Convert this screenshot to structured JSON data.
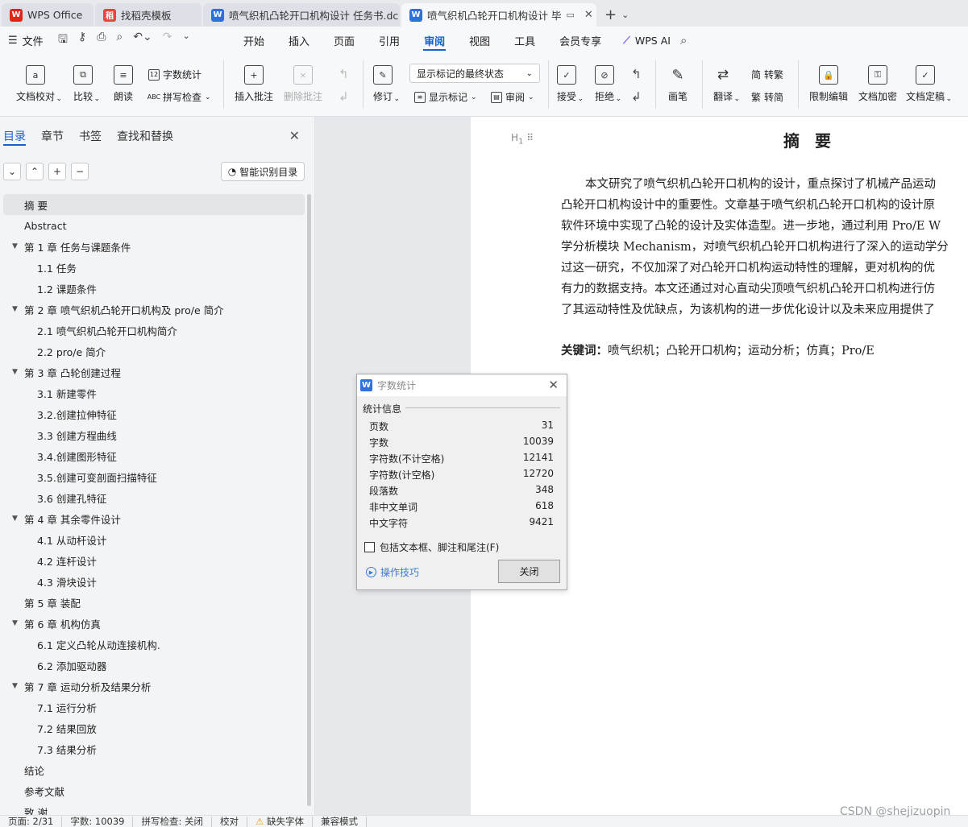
{
  "tabs": [
    {
      "label": "WPS Office",
      "icon": "wps-logo-icon",
      "color": "#e0261b"
    },
    {
      "label": "找稻壳模板",
      "icon": "docer-icon",
      "color": "#e8453c"
    },
    {
      "label": "喷气织机凸轮开口机构设计 任务书.dc",
      "icon": "word-doc-icon",
      "color": "#2f6fde"
    },
    {
      "label": "喷气织机凸轮开口机构设计 毕",
      "icon": "word-doc-icon",
      "color": "#2f6fde"
    }
  ],
  "menu": {
    "file": "文件",
    "tabs": [
      "开始",
      "插入",
      "页面",
      "引用",
      "审阅",
      "视图",
      "工具",
      "会员专享"
    ],
    "active_tab": "审阅",
    "wps_ai": "WPS AI"
  },
  "ribbon": {
    "doc_proof": "文档校对",
    "compare": "比较",
    "read_aloud": "朗读",
    "word_count": "字数统计",
    "spell_check": "拼写检查",
    "insert_comment": "插入批注",
    "delete_comment": "删除批注",
    "track_changes": "修订",
    "markup_state": "显示标记的最终状态",
    "show_markup": "显示标记",
    "review": "审阅",
    "accept": "接受",
    "reject": "拒绝",
    "pen": "画笔",
    "translate": "翻译",
    "to_traditional": "转繁",
    "to_simplified": "转简",
    "restrict_edit": "限制编辑",
    "encrypt": "文档加密",
    "finalize": "文档定稿"
  },
  "nav": {
    "tabs": [
      "目录",
      "章节",
      "书签",
      "查找和替换"
    ],
    "smart_toc": "智能识别目录",
    "toc": [
      {
        "text": "摘  要",
        "level": 0,
        "expand": false,
        "selected": true
      },
      {
        "text": "Abstract",
        "level": 0,
        "expand": false
      },
      {
        "text": "第 1 章  任务与课题条件",
        "level": 0,
        "expand": true
      },
      {
        "text": "1.1  任务",
        "level": 1
      },
      {
        "text": "1.2  课题条件",
        "level": 1
      },
      {
        "text": "第 2 章  喷气织机凸轮开口机构及 pro/e 简介",
        "level": 0,
        "expand": true
      },
      {
        "text": "2.1  喷气织机凸轮开口机构简介",
        "level": 1
      },
      {
        "text": "2.2 pro/e 简介",
        "level": 1
      },
      {
        "text": "第 3 章  凸轮创建过程",
        "level": 0,
        "expand": true
      },
      {
        "text": "3.1  新建零件",
        "level": 1
      },
      {
        "text": "3.2.创建拉伸特征",
        "level": 1
      },
      {
        "text": "3.3  创建方程曲线",
        "level": 1
      },
      {
        "text": "3.4.创建图形特征",
        "level": 1
      },
      {
        "text": "3.5.创建可变剖面扫描特征",
        "level": 1
      },
      {
        "text": "3.6 创建孔特征",
        "level": 1
      },
      {
        "text": "第 4 章    其余零件设计",
        "level": 0,
        "expand": true
      },
      {
        "text": "4.1 从动杆设计",
        "level": 1
      },
      {
        "text": "4.2 连杆设计",
        "level": 1
      },
      {
        "text": "4.3 滑块设计",
        "level": 1
      },
      {
        "text": "第 5 章  装配",
        "level": 0,
        "expand": false
      },
      {
        "text": "第 6 章  机构仿真",
        "level": 0,
        "expand": true
      },
      {
        "text": "6.1  定义凸轮从动连接机构.",
        "level": 1
      },
      {
        "text": "6.2  添加驱动器",
        "level": 1
      },
      {
        "text": "第 7 章    运动分析及结果分析",
        "level": 0,
        "expand": true
      },
      {
        "text": "7.1  运行分析",
        "level": 1
      },
      {
        "text": "7.2    结果回放",
        "level": 1
      },
      {
        "text": "7.3    结果分析",
        "level": 1
      },
      {
        "text": "结论",
        "level": 0,
        "expand": false
      },
      {
        "text": "参考文献",
        "level": 0,
        "expand": false
      },
      {
        "text": "致  谢",
        "level": 0,
        "expand": false
      }
    ]
  },
  "document": {
    "heading_marker": "H",
    "title": "摘 要",
    "lines": [
      "本文研究了喷气织机凸轮开口机构的设计，重点探讨了机械产品运动",
      "凸轮开口机构设计中的重要性。文章基于喷气织机凸轮开口机构的设计原",
      "软件环境中实现了凸轮的设计及实体造型。进一步地，通过利用 Pro/E W",
      "学分析模块 Mechanism，对喷气织机凸轮开口机构进行了深入的运动学分",
      "过这一研究，不仅加深了对凸轮开口机构运动特性的理解，更对机构的优",
      "有力的数据支持。本文还通过对心直动尖顶喷气织机凸轮开口机构进行仿",
      "了其运动特性及优缺点，为该机构的进一步优化设计以及未来应用提供了"
    ],
    "keywords_label": "关键词：",
    "keywords": "喷气织机；凸轮开口机构；运动分析；仿真；Pro/E"
  },
  "dialog": {
    "title": "字数统计",
    "group": "统计信息",
    "stats": [
      {
        "label": "页数",
        "value": "31"
      },
      {
        "label": "字数",
        "value": "10039"
      },
      {
        "label": "字符数(不计空格)",
        "value": "12141"
      },
      {
        "label": "字符数(计空格)",
        "value": "12720"
      },
      {
        "label": "段落数",
        "value": "348"
      },
      {
        "label": "非中文单词",
        "value": "618"
      },
      {
        "label": "中文字符",
        "value": "9421"
      }
    ],
    "checkbox": "包括文本框、脚注和尾注(F)",
    "tips": "操作技巧",
    "close": "关闭"
  },
  "status": {
    "page": "页面: 2/31",
    "words": "字数: 10039",
    "spell": "拼写检查: 关闭",
    "proof": "校对",
    "missing_font": "缺失字体",
    "compat": "兼容模式"
  },
  "watermark": "CSDN @shejizuopin"
}
